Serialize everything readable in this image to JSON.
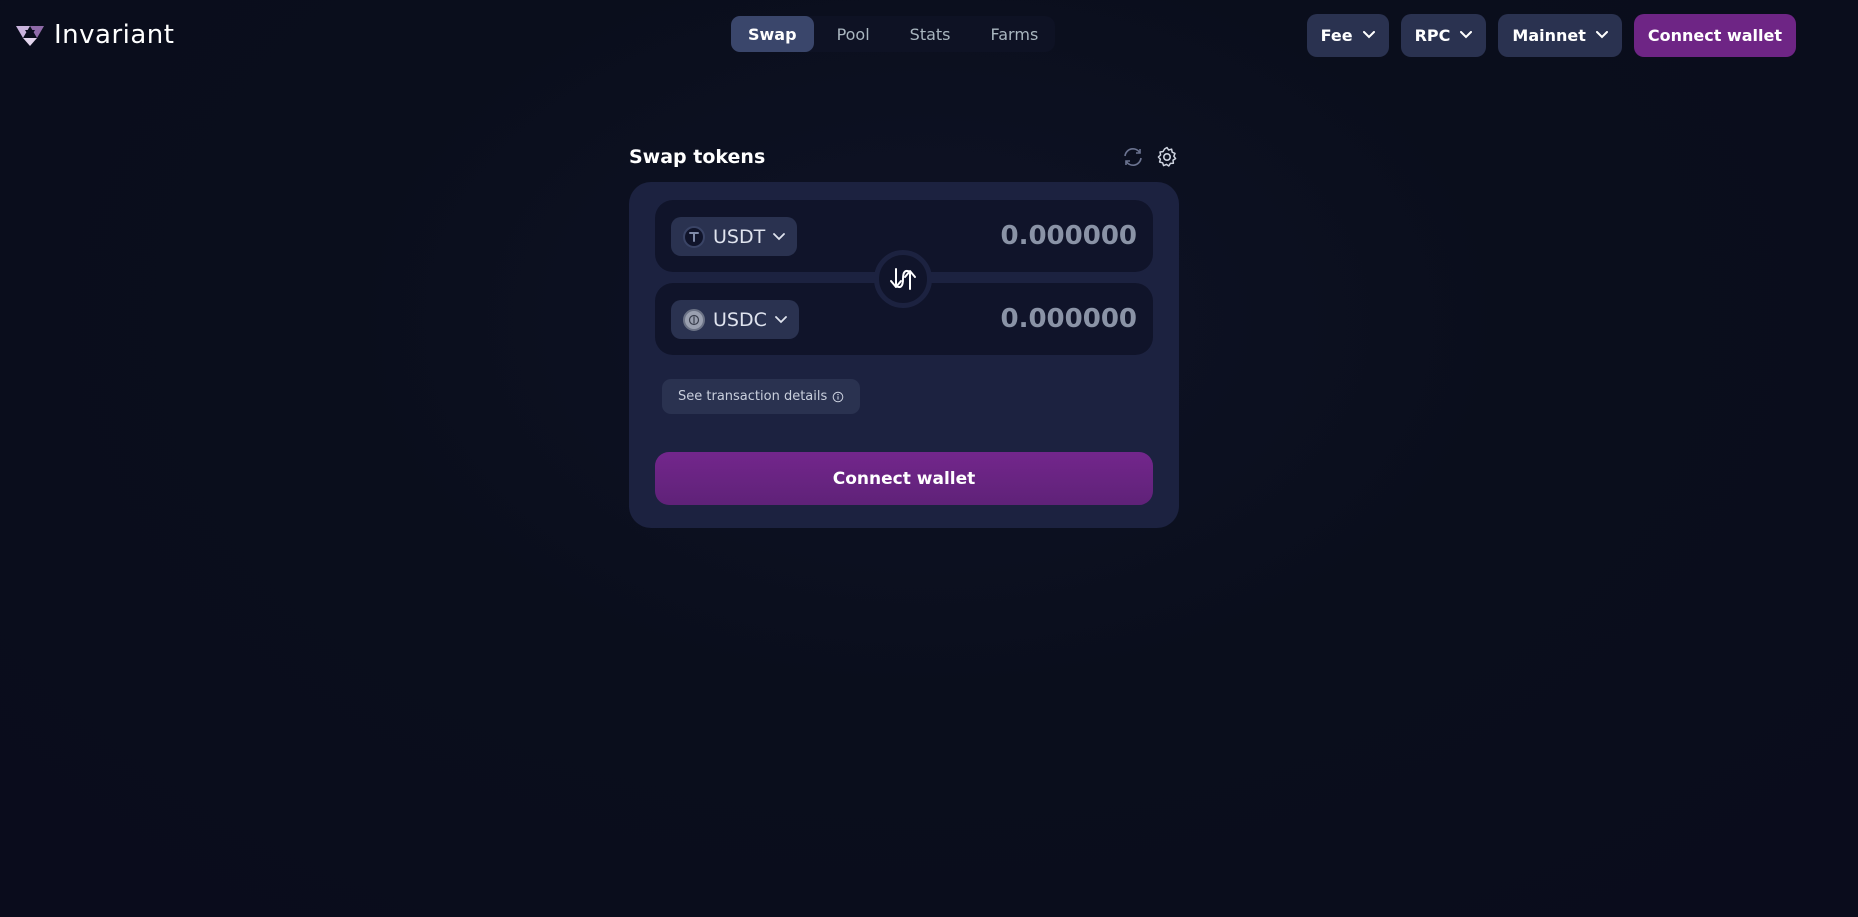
{
  "brand": {
    "name": "Invariant"
  },
  "nav": {
    "items": [
      {
        "label": "Swap",
        "active": true
      },
      {
        "label": "Pool",
        "active": false
      },
      {
        "label": "Stats",
        "active": false
      },
      {
        "label": "Farms",
        "active": false
      }
    ]
  },
  "header": {
    "fee_label": "Fee",
    "rpc_label": "RPC",
    "network_label": "Mainnet",
    "connect_label": "Connect wallet"
  },
  "swap": {
    "title": "Swap tokens",
    "from": {
      "token": "USDT",
      "amount": "0.000000",
      "icon": "usdt-logo-icon"
    },
    "to": {
      "token": "USDC",
      "amount": "0.000000",
      "icon": "usdc-logo-icon"
    },
    "details_label": "See transaction details",
    "connect_label": "Connect wallet"
  },
  "colors": {
    "background": "#0b0d1e",
    "card": "#1c2240",
    "field": "#10142a",
    "control": "#2a3250",
    "active_tab": "#3a466b",
    "accent": "#6e2585"
  },
  "icons": {
    "logo": "invariant-logo-icon",
    "refresh": "refresh-icon",
    "settings": "gear-icon",
    "swap_switch": "swap-arrows-icon",
    "info": "info-icon",
    "dropdown": "chevron-down-icon"
  }
}
